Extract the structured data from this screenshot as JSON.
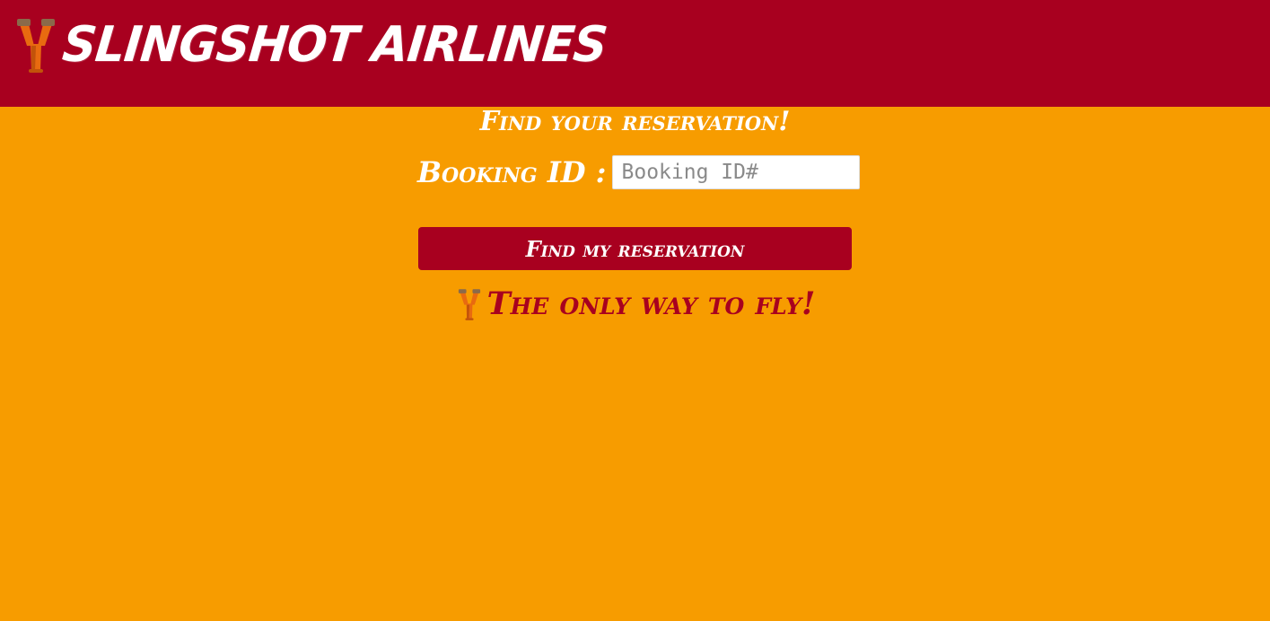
{
  "header": {
    "brand_name": "Slingshot Airlines",
    "logo_icon": "slingshot-icon",
    "background_color": "#a8001f"
  },
  "main": {
    "background_color": "#f79c00",
    "title": "Find your reservation!",
    "booking_label": "Booking ID :",
    "booking_input": {
      "value": "",
      "placeholder": "Booking ID#"
    },
    "find_button_label": "Find my reservation",
    "tagline": "The only way to fly!",
    "tagline_icon": "slingshot-icon"
  }
}
